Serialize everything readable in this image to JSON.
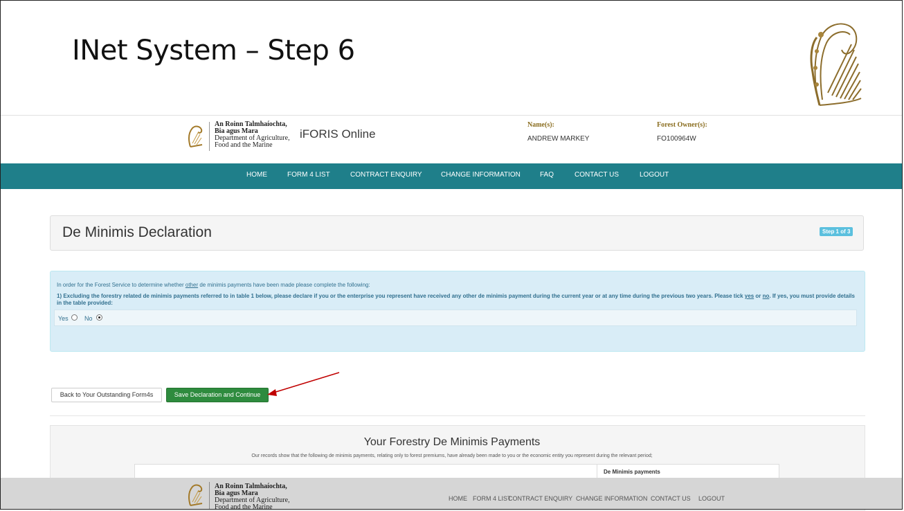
{
  "slide": {
    "title": "INet System – Step 6"
  },
  "header": {
    "dept_line1": "An Roinn Talmhaíochta,",
    "dept_line2": "Bia agus Mara",
    "dept_line3": "Department of Agriculture,",
    "dept_line4": "Food and the Marine",
    "app_title": "iFORIS Online",
    "names_label": "Name(s):",
    "names_value": "ANDREW MARKEY",
    "owner_label": "Forest Owner(s):",
    "owner_value": "FO100964W"
  },
  "nav": {
    "items": [
      "HOME",
      "FORM 4 LIST",
      "CONTRACT ENQUIRY",
      "CHANGE INFORMATION",
      "FAQ",
      "CONTACT US",
      "LOGOUT"
    ]
  },
  "page": {
    "heading": "De Minimis Declaration",
    "step_badge": "Step 1 of 3"
  },
  "declaration": {
    "intro_before": "In order for the Forest Service to determine whether ",
    "intro_link": "other",
    "intro_after": " de minimis payments have been made please complete the following:",
    "question_main": "1) Excluding the forestry related de minimis payments referred to in table 1 below, please declare if you or the enterprise you represent have received any other de minimis payment during the current year or at any time during the previous two years. Please tick ",
    "question_yes": "yes",
    "question_or": " or ",
    "question_no": "no",
    "question_end": ". If yes, you must provide details in the table provided:",
    "yes_label": "Yes",
    "no_label": "No",
    "selected": "No"
  },
  "buttons": {
    "back_label": "Back to Your Outstanding Form4s",
    "save_label": "Save Declaration and Continue"
  },
  "payments": {
    "title": "Your Forestry De Minimis Payments",
    "description": "Our records show that the following de minimis payments, relating only to forest premiums, have already been made to you or the economic entity you represent during the relevant period;",
    "column_header": "De Minimis payments"
  },
  "footer": {
    "dept_line1": "An Roinn Talmhaíochta,",
    "dept_line2": "Bia agus Mara",
    "dept_line3": "Department of Agriculture,",
    "dept_line4": "Food and the Marine",
    "links": [
      "HOME",
      "FORM 4 LIST",
      "CONTRACT ENQUIRY",
      "CHANGE INFORMATION",
      "CONTACT US",
      "LOGOUT"
    ]
  },
  "colors": {
    "nav_bg": "#1f7f8a",
    "save_button": "#2e8b3e",
    "info_panel": "#d9edf7",
    "annotation_arrow": "#c00000"
  },
  "icons": {
    "harp": "harp-emblem-icon",
    "arrow": "annotation-arrow-icon"
  }
}
